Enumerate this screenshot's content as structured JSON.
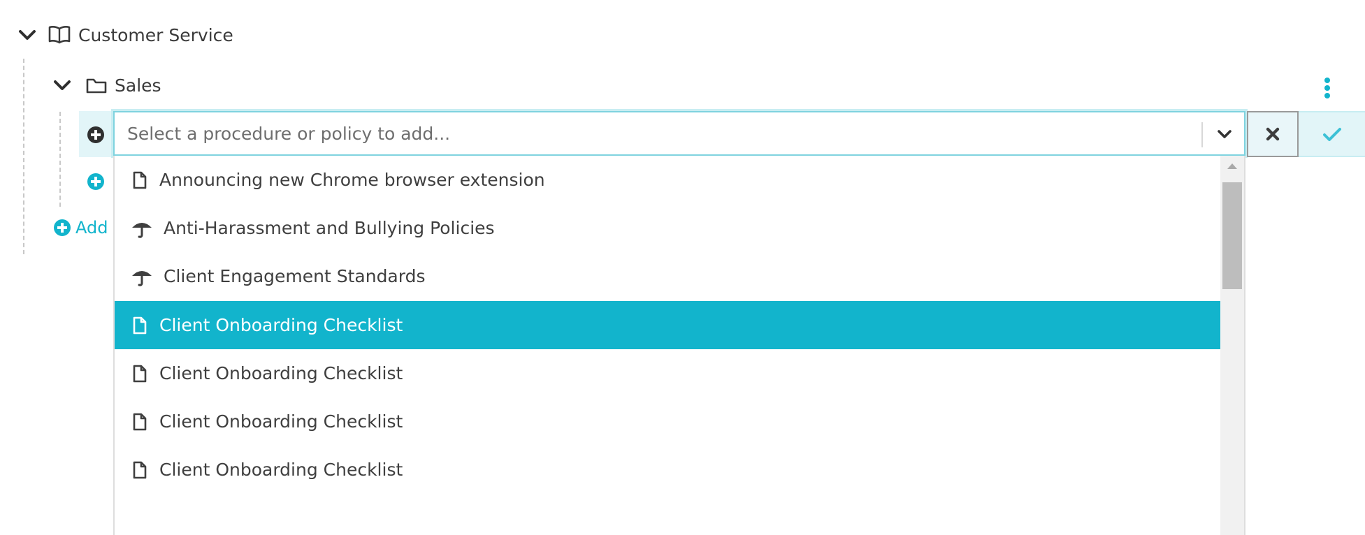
{
  "tree": {
    "root": {
      "label": "Customer Service",
      "expand_icon": "chevron-down-icon",
      "icon": "book-icon"
    },
    "child": {
      "label": "Sales",
      "expand_icon": "chevron-down-icon",
      "icon": "folder-icon",
      "menu_icon": "vertical-dots-icon"
    },
    "add_link": {
      "label": "Add",
      "icon": "plus-circle-icon"
    }
  },
  "picker": {
    "placeholder": "Select a procedure or policy to add...",
    "dropdown_icon": "chevron-down-icon",
    "cancel_icon": "close-icon",
    "confirm_icon": "check-icon",
    "row_icon": "plus-circle-icon",
    "options": [
      {
        "label": "Announcing new Chrome browser extension",
        "icon": "document-icon",
        "selected": false
      },
      {
        "label": "Anti-Harassment and Bullying Policies",
        "icon": "umbrella-icon",
        "selected": false
      },
      {
        "label": "Client Engagement Standards",
        "icon": "umbrella-icon",
        "selected": false
      },
      {
        "label": "Client Onboarding Checklist",
        "icon": "document-icon",
        "selected": true
      },
      {
        "label": "Client Onboarding Checklist",
        "icon": "document-icon",
        "selected": false
      },
      {
        "label": "Client Onboarding Checklist",
        "icon": "document-icon",
        "selected": false
      },
      {
        "label": "Client Onboarding Checklist",
        "icon": "document-icon",
        "selected": false
      }
    ]
  },
  "colors": {
    "accent": "#12b4cc",
    "selected_text": "#ffffff"
  }
}
